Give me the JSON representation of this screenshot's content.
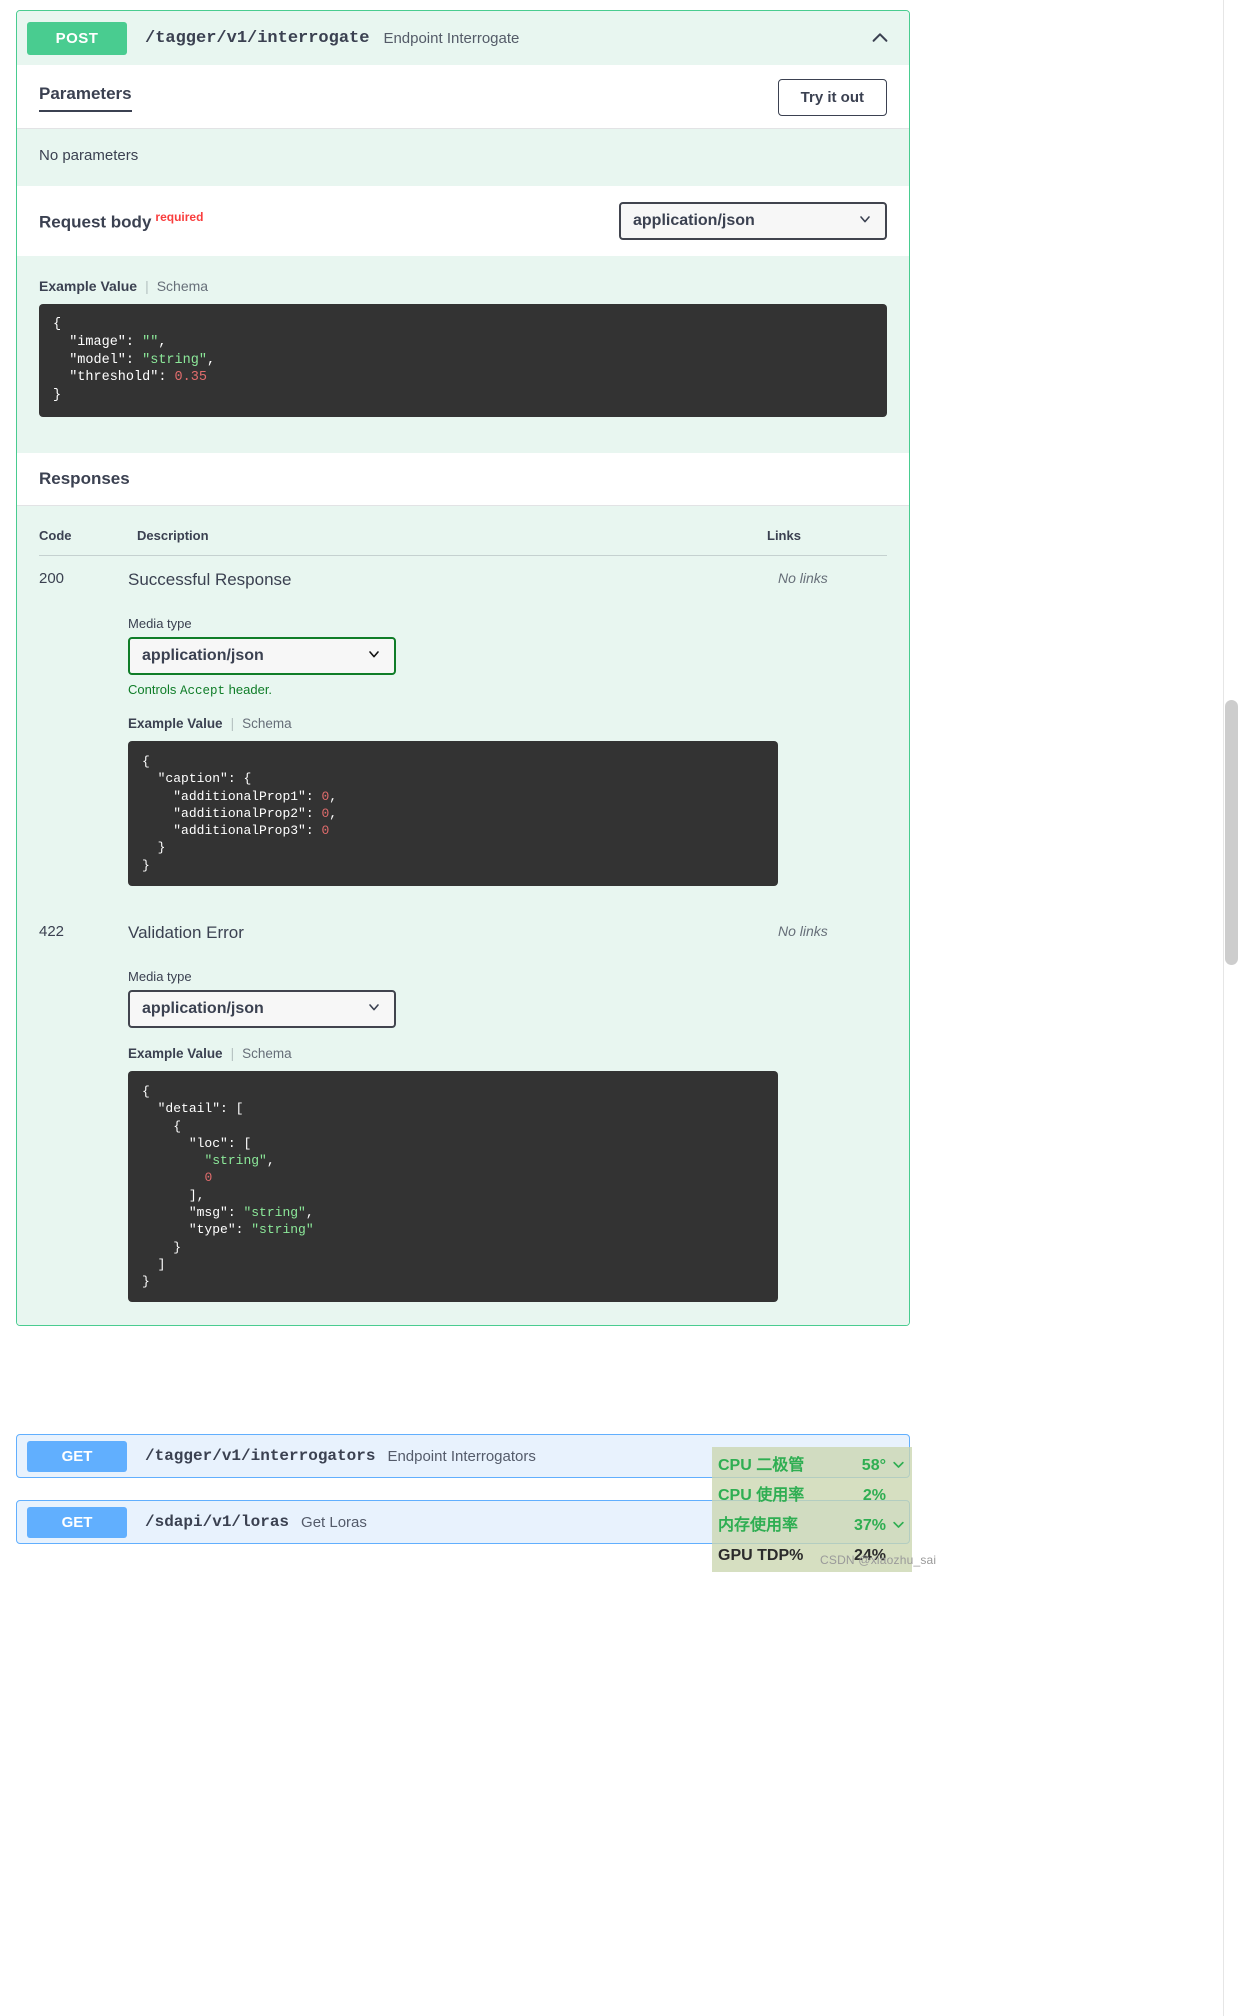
{
  "operation": {
    "method": "POST",
    "path": "/tagger/v1/interrogate",
    "summary": "Endpoint Interrogate",
    "collapse_icon": "chevron-up-icon"
  },
  "parameters": {
    "tab_label": "Parameters",
    "try_it_out_label": "Try it out",
    "empty_text": "No parameters"
  },
  "request_body": {
    "label": "Request body",
    "required_label": "required",
    "media_type": "application/json",
    "example_tab": "Example Value",
    "schema_tab": "Schema",
    "example_json": "{\n  \"image\": \"\",\n  \"model\": \"string\",\n  \"threshold\": 0.35\n}",
    "example_parts": [
      {
        "text": "{",
        "kind": "plain"
      },
      {
        "text": "  \"image\": ",
        "kind": "plain"
      },
      {
        "text": "\"\"",
        "kind": "string"
      },
      {
        "text": ",",
        "kind": "plain"
      },
      {
        "text": "  \"model\": ",
        "kind": "plain"
      },
      {
        "text": "\"string\"",
        "kind": "string"
      },
      {
        "text": ",",
        "kind": "plain"
      },
      {
        "text": "  \"threshold\": ",
        "kind": "plain"
      },
      {
        "text": "0.35",
        "kind": "number"
      },
      {
        "text": "}",
        "kind": "plain"
      }
    ]
  },
  "responses": {
    "title": "Responses",
    "columns": {
      "code": "Code",
      "description": "Description",
      "links": "Links"
    },
    "items": [
      {
        "code": "200",
        "description": "Successful Response",
        "links": "No links",
        "media_type_label": "Media type",
        "media_type": "application/json",
        "accept_note_prefix": "Controls ",
        "accept_note_mono": "Accept",
        "accept_note_suffix": " header.",
        "example_tab": "Example Value",
        "schema_tab": "Schema",
        "example_json": "{\n  \"caption\": {\n    \"additionalProp1\": 0,\n    \"additionalProp2\": 0,\n    \"additionalProp3\": 0\n  }\n}"
      },
      {
        "code": "422",
        "description": "Validation Error",
        "links": "No links",
        "media_type_label": "Media type",
        "media_type": "application/json",
        "example_tab": "Example Value",
        "schema_tab": "Schema",
        "example_json": "{\n  \"detail\": [\n    {\n      \"loc\": [\n        \"string\",\n        0\n      ],\n      \"msg\": \"string\",\n      \"type\": \"string\"\n    }\n  ]\n}"
      }
    ]
  },
  "other_endpoints": [
    {
      "method": "GET",
      "path": "/tagger/v1/interrogators",
      "summary": "Endpoint Interrogators"
    },
    {
      "method": "GET",
      "path": "/sdapi/v1/loras",
      "summary": "Get Loras"
    }
  ],
  "gpu_overlay": {
    "rows": [
      {
        "name": "CPU 二极管",
        "value": "58°",
        "color": "#2fae52"
      },
      {
        "name": "CPU 使用率",
        "value": "2%",
        "color": "#2fae52"
      },
      {
        "name": "内存使用率",
        "value": "37%",
        "color": "#2fae52"
      },
      {
        "name": "GPU TDP%",
        "value": "24%",
        "color": "#2b2b2b"
      }
    ],
    "arrow": "chevron-down-icon"
  },
  "watermark": "CSDN @xiaozhu_sai",
  "colors": {
    "post_green": "#49cc90",
    "get_blue": "#61affe",
    "required_red": "#f93e3e",
    "accept_green": "#0f7d28",
    "code_bg": "#333333"
  }
}
